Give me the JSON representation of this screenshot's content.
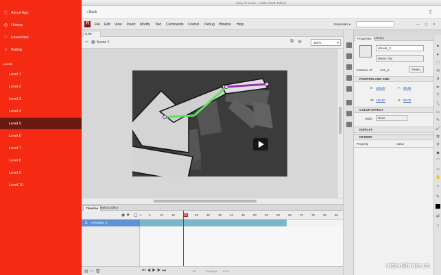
{
  "sidebar": {
    "items": [
      {
        "label": "About App",
        "icon": "info-icon"
      },
      {
        "label": "History",
        "icon": "history-icon"
      },
      {
        "label": "Favourites",
        "icon": "heart-icon"
      },
      {
        "label": "Rating",
        "icon": "star-icon"
      }
    ],
    "section_label": "Levels",
    "levels": [
      "Level 1",
      "Level 2",
      "Level 3",
      "Level 4",
      "Level 5",
      "Level 6",
      "Level 7",
      "Level 8",
      "Level 9",
      "Level 10"
    ],
    "active_level": "Level 5",
    "accent": "#f52a12",
    "active_color": "#6b1a12"
  },
  "window": {
    "title": "Easy To Learn - Adobe Flash Edition",
    "back_label": "« Back"
  },
  "menubar": {
    "logo": "Fl",
    "items": [
      "File",
      "Edit",
      "View",
      "Insert",
      "Modify",
      "Text",
      "Commands",
      "Control",
      "Debug",
      "Window",
      "Help"
    ],
    "workspace": "Essentials ▾"
  },
  "document": {
    "tab_label": "ik.fla*",
    "scene_label": "Scene 1",
    "zoom": "100%"
  },
  "timeline": {
    "tabs": [
      "Timeline",
      "Motion Editor"
    ],
    "ruler": [
      "1",
      "5",
      "10",
      "15",
      "20",
      "25",
      "30",
      "35",
      "40",
      "45",
      "50",
      "55",
      "60",
      "65",
      "70",
      "75",
      "80",
      "85"
    ],
    "layer_name": "Armature_2",
    "current_frame": "20",
    "fps": "24.00 fps",
    "time": "0.8 s"
  },
  "properties": {
    "tabs": [
      "Properties",
      "Library"
    ],
    "instance_name": "ikNode_3",
    "symbol_type": "Movie Clip",
    "instance_of_label": "Instance of:",
    "instance_of": "Arm_2",
    "swap_label": "Swap...",
    "section_position": "POSITION AND SIZE",
    "x_label": "X:",
    "x_value": "425.00",
    "y_label": "Y:",
    "y_value": "89.35",
    "w_label": "W:",
    "w_value": "156.80",
    "h_label": "H:",
    "h_value": "86.00",
    "section_color": "COLOR EFFECT",
    "style_label": "Style:",
    "style_value": "None",
    "section_display": "DISPLAY",
    "section_filters": "FILTERS",
    "col_property": "Property",
    "col_value": "Value"
  },
  "watermark": "video2brain.co"
}
